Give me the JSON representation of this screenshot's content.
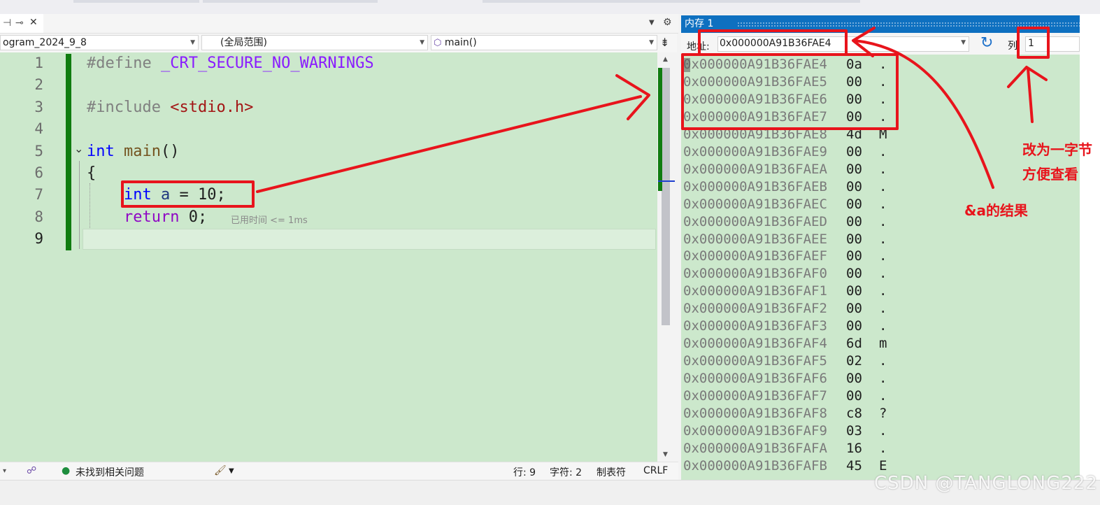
{
  "editor": {
    "tab_label": "-ı ✕",
    "nav": {
      "project": "ogram_2024_9_8",
      "scope": "(全局范围)",
      "function": "main()"
    },
    "lines": [
      {
        "num": "1",
        "tokens": [
          {
            "text": "#define ",
            "color": "#808080"
          },
          {
            "text": "_CRT_SECURE_NO_WARNINGS",
            "color": "#8a1bff"
          }
        ]
      },
      {
        "num": "2",
        "tokens": []
      },
      {
        "num": "3",
        "tokens": [
          {
            "text": "#include ",
            "color": "#808080"
          },
          {
            "text": "<stdio.h>",
            "color": "#a31515"
          }
        ]
      },
      {
        "num": "4",
        "tokens": []
      },
      {
        "num": "5",
        "tokens": [
          {
            "text": "int",
            "color": "#0000ff"
          },
          {
            "text": " main",
            "color": "#74531f"
          },
          {
            "text": "()",
            "color": "#1e1e1e"
          }
        ]
      },
      {
        "num": "6",
        "tokens": [
          {
            "text": "{",
            "color": "#1e1e1e"
          }
        ]
      },
      {
        "num": "7",
        "tokens": [
          {
            "text": "    int",
            "color": "#0000ff"
          },
          {
            "text": " a",
            "color": "#1f377f"
          },
          {
            "text": " = 10;",
            "color": "#1e1e1e"
          }
        ]
      },
      {
        "num": "8",
        "tokens": [
          {
            "text": "    return",
            "color": "#8f08c4"
          },
          {
            "text": " 0;",
            "color": "#1e1e1e"
          }
        ]
      },
      {
        "num": "9",
        "tokens": [
          {
            "text": "}",
            "color": "#1e1e1e"
          }
        ]
      }
    ],
    "perf_tip": "已用时间 <= 1ms"
  },
  "status": {
    "no_issues": "未找到相关问题",
    "line": "行: 9",
    "char": "字符: 2",
    "tab": "制表符",
    "eol": "CRLF"
  },
  "memory": {
    "title": "内存 1",
    "address_label": "地址:",
    "address_value": "0x000000A91B36FAE4",
    "columns_label": "列",
    "columns_value": "1",
    "rows": [
      {
        "addr": "0x000000A91B36FAE4",
        "hex": "0a",
        "ascii": "."
      },
      {
        "addr": "0x000000A91B36FAE5",
        "hex": "00",
        "ascii": "."
      },
      {
        "addr": "0x000000A91B36FAE6",
        "hex": "00",
        "ascii": "."
      },
      {
        "addr": "0x000000A91B36FAE7",
        "hex": "00",
        "ascii": "."
      },
      {
        "addr": "0x000000A91B36FAE8",
        "hex": "4d",
        "ascii": "M"
      },
      {
        "addr": "0x000000A91B36FAE9",
        "hex": "00",
        "ascii": "."
      },
      {
        "addr": "0x000000A91B36FAEA",
        "hex": "00",
        "ascii": "."
      },
      {
        "addr": "0x000000A91B36FAEB",
        "hex": "00",
        "ascii": "."
      },
      {
        "addr": "0x000000A91B36FAEC",
        "hex": "00",
        "ascii": "."
      },
      {
        "addr": "0x000000A91B36FAED",
        "hex": "00",
        "ascii": "."
      },
      {
        "addr": "0x000000A91B36FAEE",
        "hex": "00",
        "ascii": "."
      },
      {
        "addr": "0x000000A91B36FAEF",
        "hex": "00",
        "ascii": "."
      },
      {
        "addr": "0x000000A91B36FAF0",
        "hex": "00",
        "ascii": "."
      },
      {
        "addr": "0x000000A91B36FAF1",
        "hex": "00",
        "ascii": "."
      },
      {
        "addr": "0x000000A91B36FAF2",
        "hex": "00",
        "ascii": "."
      },
      {
        "addr": "0x000000A91B36FAF3",
        "hex": "00",
        "ascii": "."
      },
      {
        "addr": "0x000000A91B36FAF4",
        "hex": "6d",
        "ascii": "m"
      },
      {
        "addr": "0x000000A91B36FAF5",
        "hex": "02",
        "ascii": "."
      },
      {
        "addr": "0x000000A91B36FAF6",
        "hex": "00",
        "ascii": "."
      },
      {
        "addr": "0x000000A91B36FAF7",
        "hex": "00",
        "ascii": "."
      },
      {
        "addr": "0x000000A91B36FAF8",
        "hex": "c8",
        "ascii": "?"
      },
      {
        "addr": "0x000000A91B36FAF9",
        "hex": "03",
        "ascii": "."
      },
      {
        "addr": "0x000000A91B36FAFA",
        "hex": "16",
        "ascii": "."
      },
      {
        "addr": "0x000000A91B36FAFB",
        "hex": "45",
        "ascii": "E"
      }
    ]
  },
  "annotations": {
    "amp_a_result": "&a的结果",
    "one_byte_line1": "改为一字节",
    "one_byte_line2": "方便查看",
    "color": "#e8141c"
  },
  "watermark": "CSDN @TANGLONG222",
  "icons": [
    "pin-icon",
    "close-icon",
    "dropdown-arrow-icon",
    "cube-icon",
    "split-icon",
    "refresh-icon",
    "check-circle-icon",
    "brush-icon",
    "settings-gear-icon"
  ]
}
